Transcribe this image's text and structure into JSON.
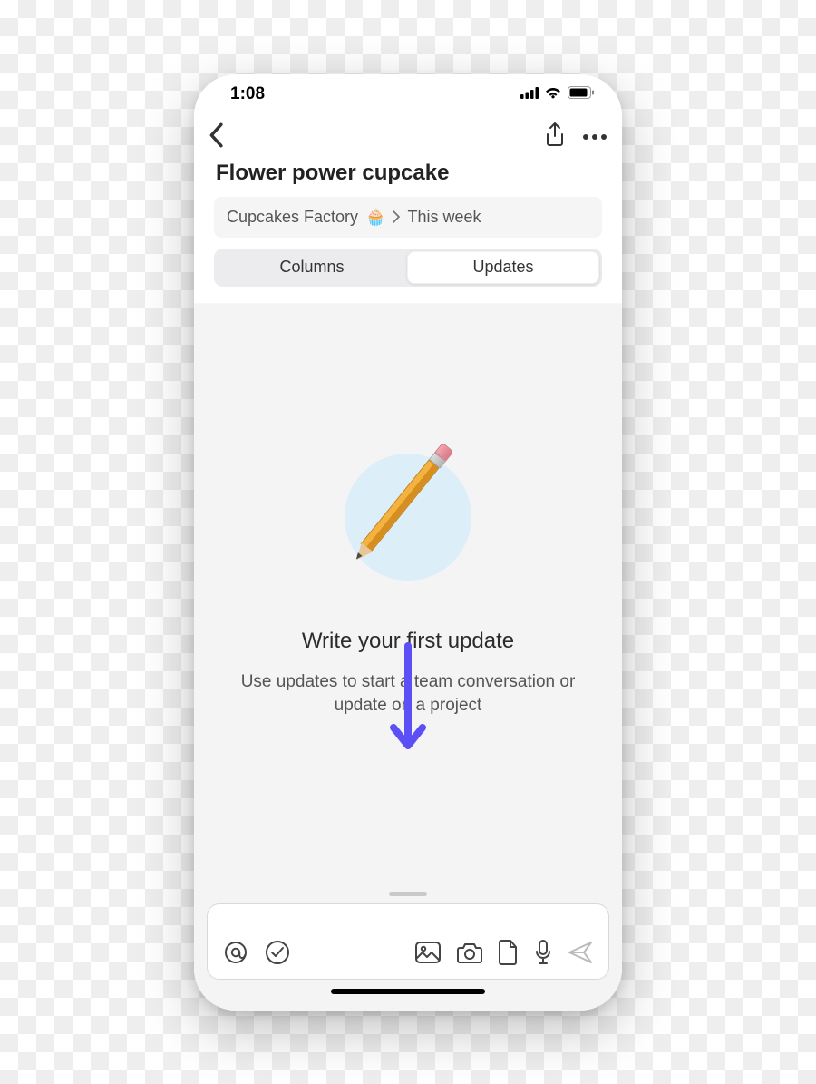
{
  "status": {
    "time": "1:08"
  },
  "header": {
    "title": "Flower power cupcake",
    "breadcrumb": {
      "parent": "Cupcakes Factory",
      "parent_emoji": "🧁",
      "child": "This week"
    }
  },
  "tabs": {
    "columns": "Columns",
    "updates": "Updates",
    "active": "updates"
  },
  "empty_state": {
    "title": "Write your first update",
    "subtitle": "Use updates to start a team conversation or update on a project"
  },
  "icons": {
    "back": "chevron-left",
    "share": "share",
    "more": "more",
    "mention": "at",
    "task": "check-circle",
    "photo": "photo",
    "camera": "camera",
    "file": "document",
    "mic": "microphone",
    "send": "send"
  }
}
